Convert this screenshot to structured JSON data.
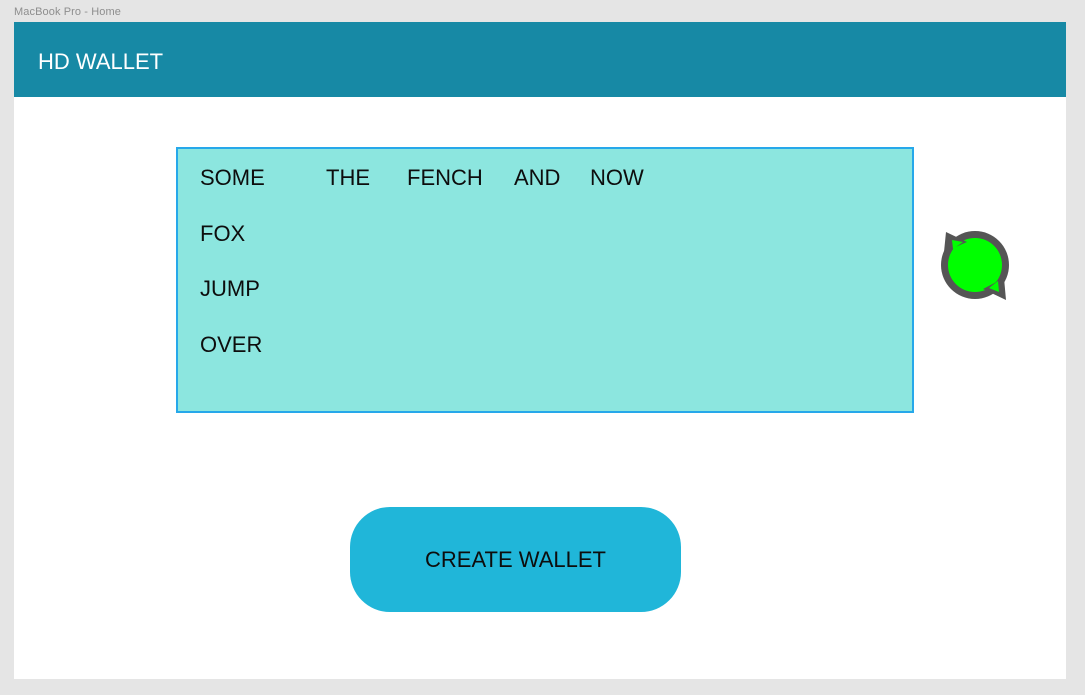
{
  "frame": {
    "label": "MacBook Pro - Home"
  },
  "header": {
    "title": "HD WALLET"
  },
  "mnemonic": {
    "words": [
      "SOME",
      "THE",
      "FENCH",
      "AND",
      "NOW",
      "FOX",
      "JUMP",
      "OVER"
    ]
  },
  "refresh": {
    "icon": "refresh-icon",
    "fill_color": "#00ff00",
    "ring_color": "#555555"
  },
  "actions": {
    "create_wallet_label": "CREATE WALLET"
  },
  "colors": {
    "header_bg": "#1789a5",
    "mnemonic_bg": "#8ce6df",
    "mnemonic_border": "#26a8ea",
    "button_bg": "#20b6d9"
  }
}
